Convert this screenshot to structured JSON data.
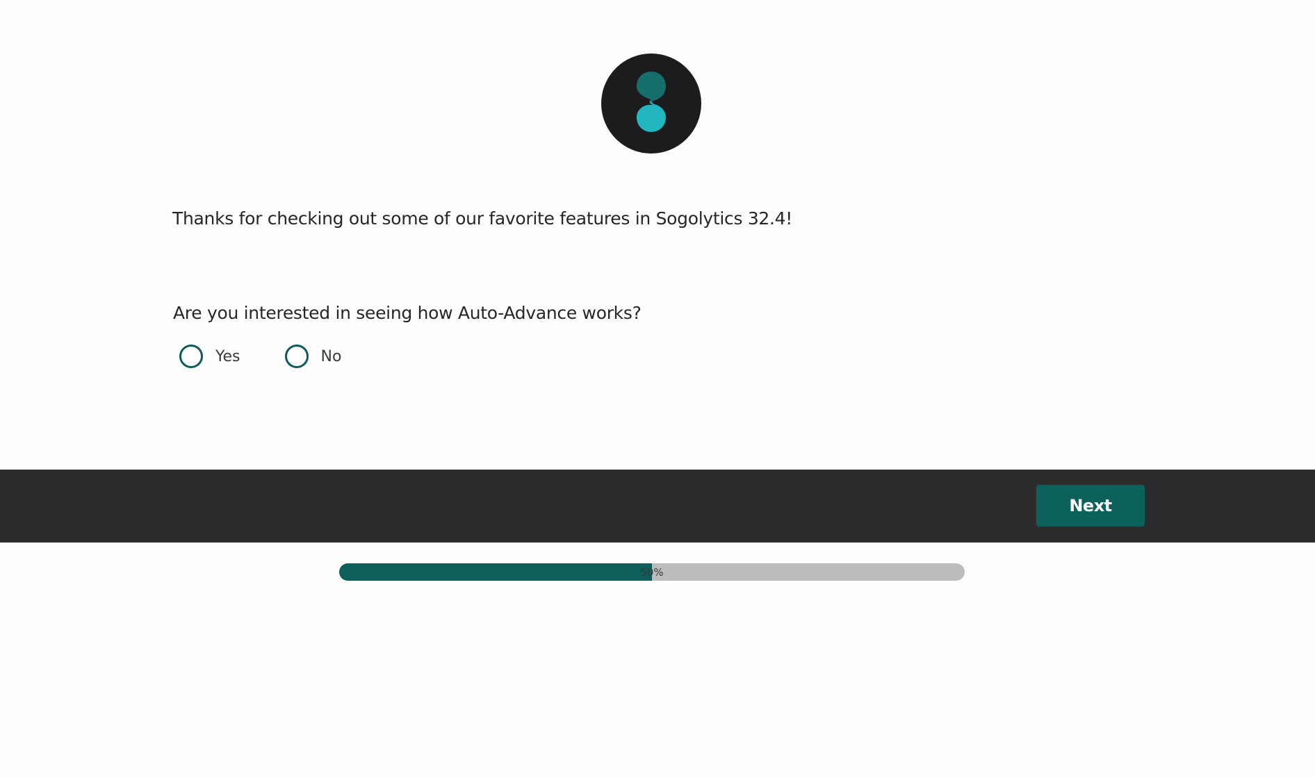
{
  "logo": {
    "icon": "sogolytics-logo-icon",
    "colors": {
      "circle": "#1c1c1e",
      "top_drop": "#176f6b",
      "bottom_drop": "#22b6c0"
    }
  },
  "survey": {
    "intro_text": "Thanks for checking out some of our favorite features in Sogolytics 32.4!",
    "question": "Are you interested in seeing how Auto-Advance works?",
    "options": [
      {
        "label": "Yes",
        "selected": false
      },
      {
        "label": "No",
        "selected": false
      }
    ]
  },
  "footer": {
    "next_label": "Next",
    "colors": {
      "bar": "#2c2c2e",
      "button": "#0c615c"
    }
  },
  "progress": {
    "percent": 50,
    "label": "50%",
    "colors": {
      "fill": "#0c5f5b",
      "track": "#bcbcbe"
    }
  }
}
